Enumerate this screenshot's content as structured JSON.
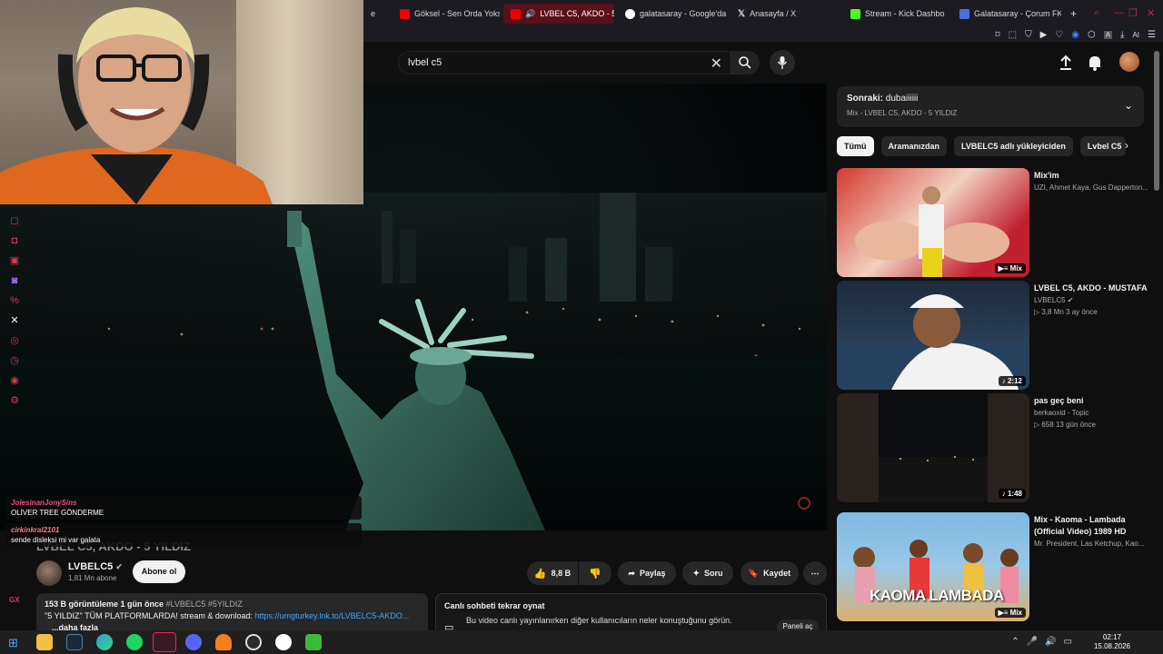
{
  "browser": {
    "tabs": [
      {
        "label": "e",
        "favicon": "youtube-icon",
        "active": false
      },
      {
        "label": "Göksel - Sen Orda Yoksun",
        "favicon": "youtube-icon",
        "active": false
      },
      {
        "label": "LVBEL C5, AKDO - 5 YI",
        "favicon": "youtube-icon",
        "active": true
      },
      {
        "label": "galatasaray - Google'da",
        "favicon": "google-icon",
        "active": false
      },
      {
        "label": "Anasayfa / X",
        "favicon": "x-icon",
        "active": false
      },
      {
        "label": "Stream - Kick Dashbo",
        "favicon": "kick-icon",
        "active": false
      },
      {
        "label": "Galatasaray - Çorum FK",
        "favicon": "page-icon",
        "active": false
      }
    ],
    "new_tab": "+",
    "toolbar_icons": [
      "bookmark-icon",
      "screenshot-icon",
      "shield-icon",
      "download-icon",
      "heart-icon",
      "extension-icon",
      "puzzle-icon",
      "user-icon",
      "download-icon",
      "ai-icon",
      "menu-icon"
    ],
    "ai_label": "AI"
  },
  "youtube": {
    "search_query": "lvbel c5",
    "video": {
      "title": "LVBEL C5, AKDO - 5 YILDIZ",
      "channel": "LVBELC5",
      "subscribers": "1,81 Mn abone",
      "subscribe_label": "Abone ol",
      "likes": "8,8 B",
      "share_label": "Paylaş",
      "ask_label": "Soru",
      "save_label": "Kaydet",
      "more_label": "⋯",
      "views_date": "153 B görüntüleme  1 gün önce",
      "hashtags": "#LVBELC5 #5YILDIZ",
      "desc_text": "\"5 YILDIZ\" TÜM PLATFORMLARDA! stream & download: ",
      "desc_link": "https://umgturkey.lnk.to/LVBELC5-AKDO...",
      "more_text": "...daha fazla"
    },
    "chat_replay": {
      "title": "Canlı sohbeti tekrar oynat",
      "text": "Bu video canlı yayınlanırken diğer kullanıcıların neler konuştuğunu görün.",
      "button": "Paneli aç"
    },
    "up_next": {
      "label": "Sonraki:",
      "title": "dubaiiiiii",
      "subtitle": "Mix - LVBEL C5, AKDO - 5 YILDIZ"
    },
    "chips": [
      "Tümü",
      "Aramanızdan",
      "LVBELC5 adlı yükleyiciden",
      "Lvbel C5"
    ],
    "recommendations": [
      {
        "title": "Mix'im",
        "line1": "UZI, Ahmet Kaya, Gus Dapperton...",
        "line2": "",
        "badge": "Mix"
      },
      {
        "title": "LVBEL C5, AKDO - MUSTAFA",
        "line1": "LVBELC5",
        "line2": "3,8 Mn  3 ay önce",
        "badge": "2:12"
      },
      {
        "title": "pas geç beni",
        "line1": "berkaoxid - Topic",
        "line2": "658  13 gün önce",
        "badge": "1:48"
      },
      {
        "title": "Mix - Kaoma - Lambada (Official Video) 1989 HD",
        "line1": "Mr. President, Las Ketchup, Kao...",
        "line2": "",
        "badge": "Mix",
        "thumb_text": "KAOMA LAMBADA"
      }
    ]
  },
  "stream_overlay": {
    "chat": [
      {
        "user": "JolesinanJonySins",
        "text": "OLİVER TREE GÖNDERME",
        "color": "#e94f8a"
      },
      {
        "user": "cirkinkral2101",
        "text": "sende disleksi mi var galata",
        "color": "#f08080"
      }
    ]
  },
  "taskbar": {
    "time": "02:17",
    "date": "15.08.2026"
  },
  "colors": {
    "accent": "#ff0000",
    "background": "#0f0f0f",
    "link": "#3ea6ff"
  }
}
